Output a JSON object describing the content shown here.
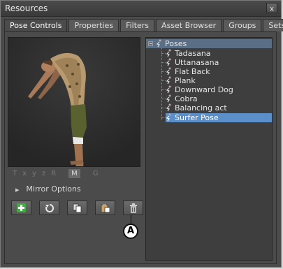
{
  "window": {
    "title": "Resources",
    "close_label": "x"
  },
  "tabs": [
    {
      "label": "Pose Controls",
      "active": true
    },
    {
      "label": "Properties"
    },
    {
      "label": "Filters"
    },
    {
      "label": "Asset Browser"
    },
    {
      "label": "Groups"
    },
    {
      "label": "Sets"
    }
  ],
  "axis_buttons": [
    "T",
    "x",
    "y",
    "z",
    "R",
    "M",
    "G"
  ],
  "mirror_options_label": "Mirror Options",
  "toolbar": {
    "add_icon": "plus-icon",
    "refresh_icon": "refresh-icon",
    "copy_icon": "copy-icon",
    "paste_icon": "paste-icon",
    "delete_icon": "trash-icon"
  },
  "callout_label": "A",
  "tree": {
    "root": "Poses",
    "items": [
      "Tadasana",
      "Uttanasana",
      "Flat Back",
      "Plank",
      "Downward Dog",
      "Cobra",
      "Balancing act",
      "Surfer Pose"
    ],
    "selected": "Surfer Pose"
  },
  "colors": {
    "selection": "#5b8fc9",
    "header": "#5a6f85",
    "add_icon": "#3fae3f"
  }
}
